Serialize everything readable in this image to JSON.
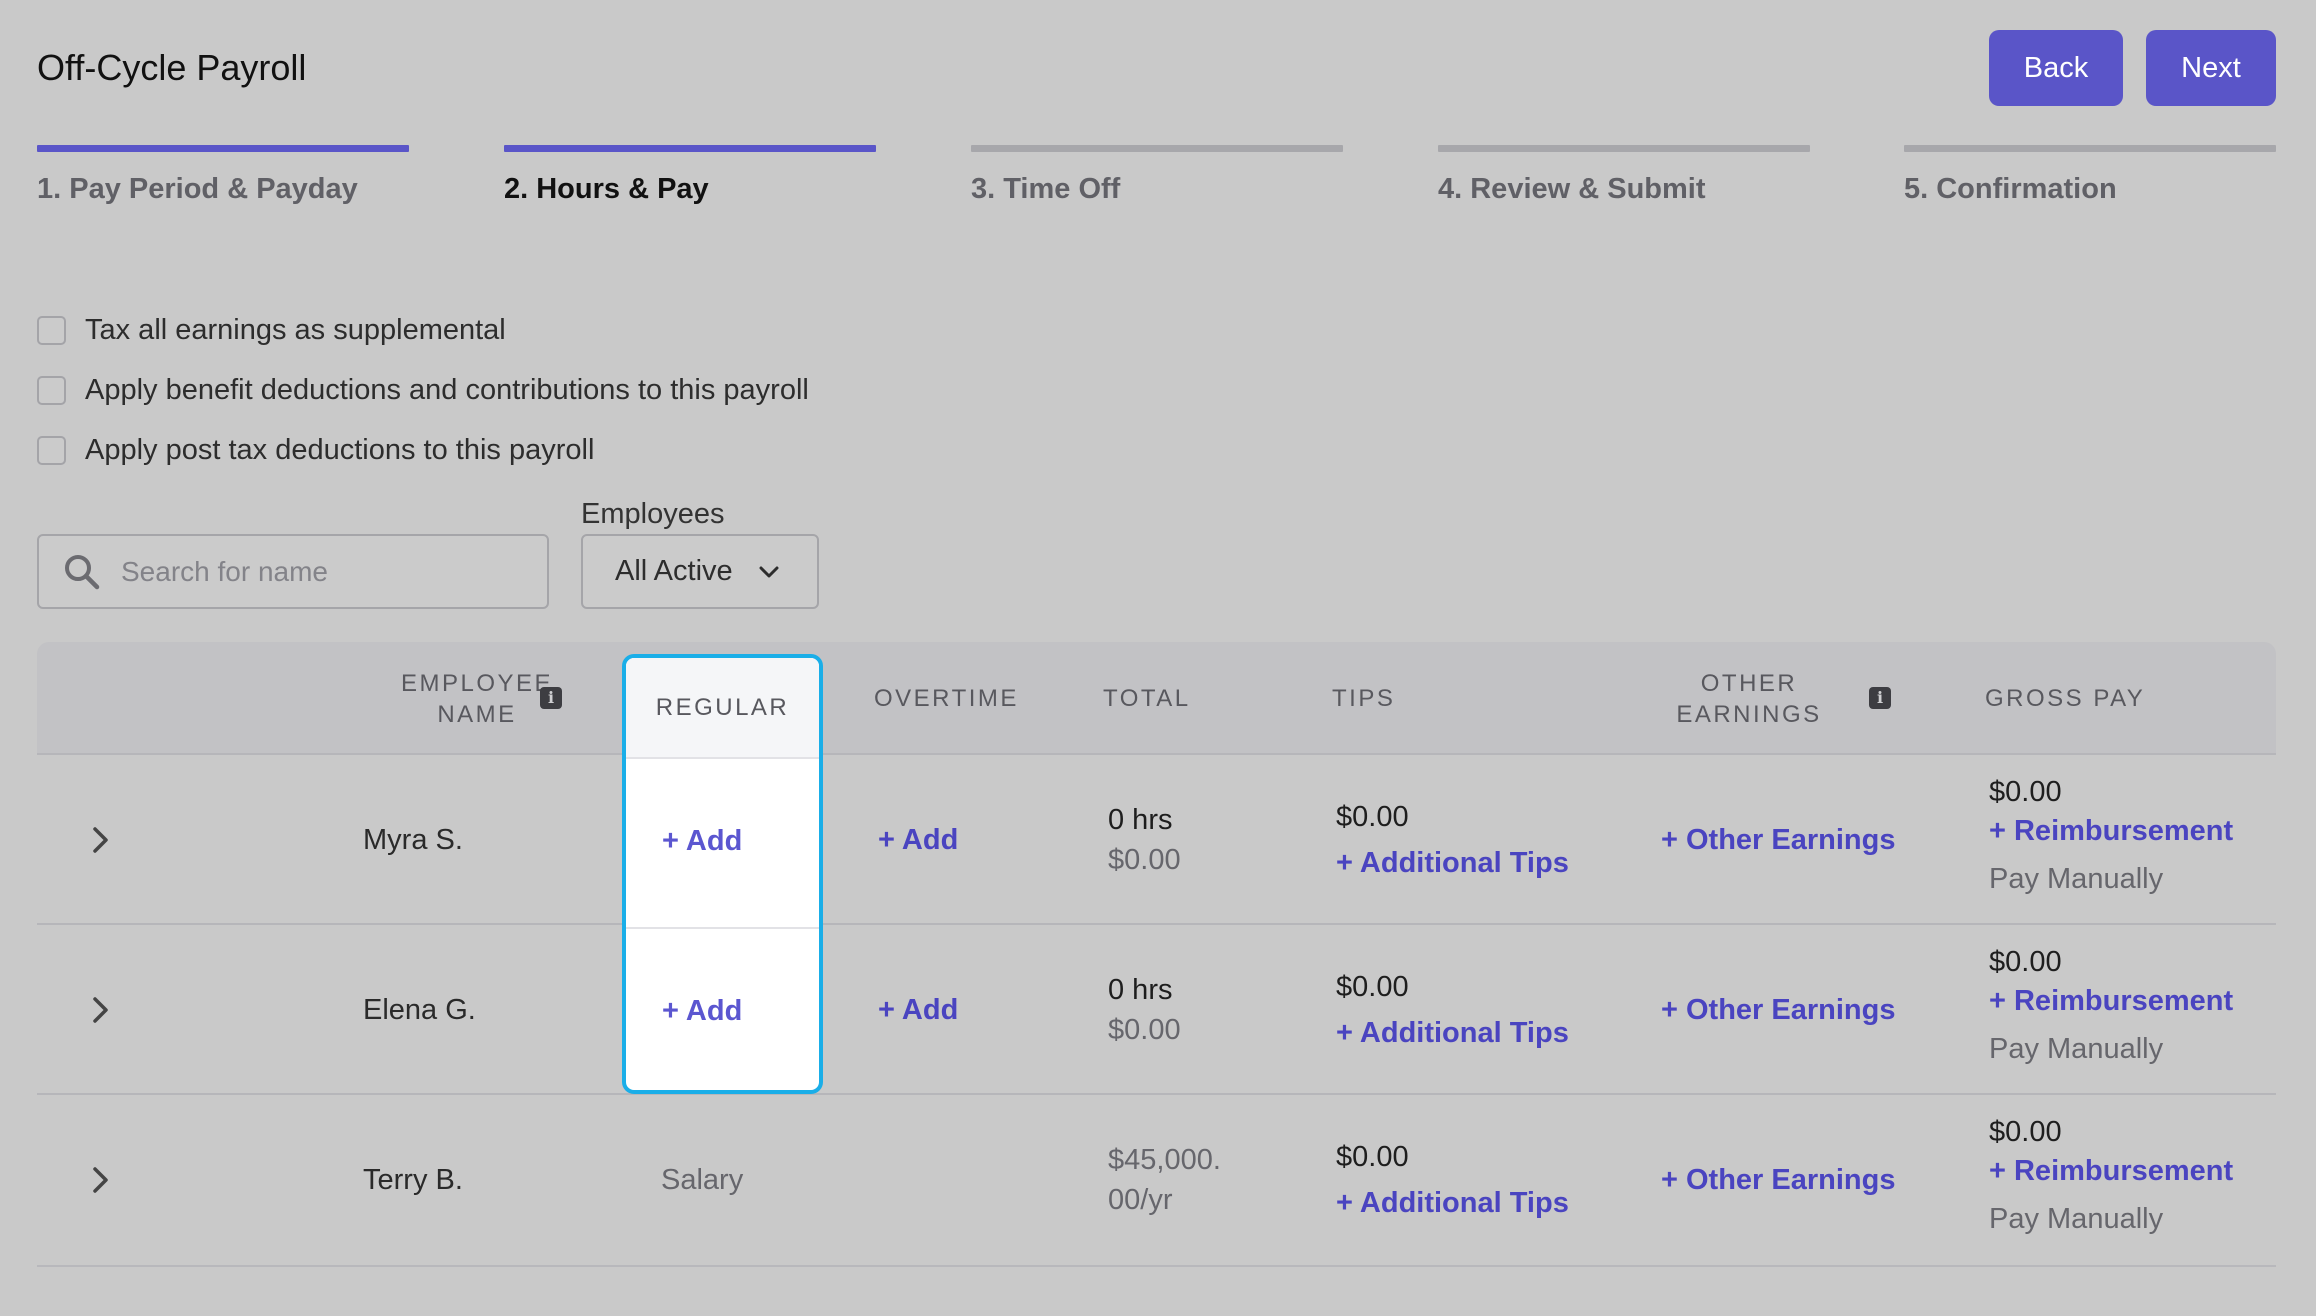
{
  "page": {
    "title": "Off-Cycle Payroll"
  },
  "header": {
    "back_label": "Back",
    "next_label": "Next"
  },
  "steps": [
    {
      "label": "1. Pay Period & Payday",
      "state": "done"
    },
    {
      "label": "2. Hours & Pay",
      "state": "active"
    },
    {
      "label": "3. Time Off",
      "state": "upcoming"
    },
    {
      "label": "4. Review & Submit",
      "state": "upcoming"
    },
    {
      "label": "5. Confirmation",
      "state": "upcoming"
    }
  ],
  "options": [
    {
      "label": "Tax all earnings as supplemental",
      "checked": false
    },
    {
      "label": "Apply benefit deductions and contributions to this payroll",
      "checked": false
    },
    {
      "label": "Apply post tax deductions to this payroll",
      "checked": false
    }
  ],
  "filters": {
    "search_placeholder": "Search for name",
    "employees_label": "Employees",
    "employees_value": "All Active"
  },
  "table": {
    "columns": {
      "employee_name": "EMPLOYEE NAME",
      "regular": "REGULAR",
      "overtime": "OVERTIME",
      "total": "TOTAL",
      "tips": "TIPS",
      "other_earnings": "OTHER EARNINGS",
      "gross_pay": "GROSS PAY"
    },
    "rows": [
      {
        "name": "Myra S.",
        "regular": "+ Add",
        "overtime": "+ Add",
        "total_hours": "0 hrs",
        "total_amount": "$0.00",
        "tips_amount": "$0.00",
        "tips_link": "+ Additional Tips",
        "other_earnings": "+ Other Earnings",
        "gross_amount": "$0.00",
        "reimbursement": "+ Reimbursement",
        "pay_method": "Pay Manually"
      },
      {
        "name": "Elena G.",
        "regular": "+ Add",
        "overtime": "+ Add",
        "total_hours": "0 hrs",
        "total_amount": "$0.00",
        "tips_amount": "$0.00",
        "tips_link": "+ Additional Tips",
        "other_earnings": "+ Other Earnings",
        "gross_amount": "$0.00",
        "reimbursement": "+ Reimbursement",
        "pay_method": "Pay Manually"
      },
      {
        "name": "Terry B.",
        "regular": "Salary",
        "total_line1": "$45,000.",
        "total_line2": "00/yr",
        "tips_amount": "$0.00",
        "tips_link": "+ Additional Tips",
        "other_earnings": "+ Other Earnings",
        "gross_amount": "$0.00",
        "reimbursement": "+ Reimbursement",
        "pay_method": "Pay Manually"
      }
    ]
  },
  "colors": {
    "accent": "#5a55c8",
    "highlight_border": "#1aaee8",
    "background": "#c9c9c9"
  }
}
